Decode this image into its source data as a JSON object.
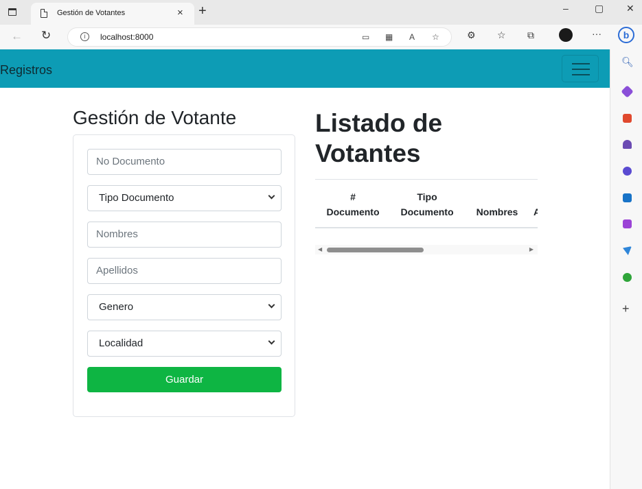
{
  "browser": {
    "tab_title": "Gestión de Votantes",
    "tab_close": "×",
    "new_tab": "+",
    "window_controls": [
      "–",
      "▢",
      "✕"
    ],
    "url": "localhost:8000",
    "toolbar_icons": [
      "app-icon",
      "qr-icon",
      "read-aloud-icon",
      "favorite-add-icon",
      "extensions-icon",
      "favorites-icon",
      "collections-icon",
      "profile-avatar",
      "more-icon"
    ],
    "more_label": "···",
    "bing_label": "b"
  },
  "sidebar": {
    "icons": [
      "search-icon",
      "shopping-icon",
      "tools-icon",
      "games-icon",
      "office-icon",
      "outlook-icon",
      "designer-icon",
      "send-icon",
      "tree-icon"
    ],
    "plus": "+"
  },
  "navbar": {
    "brand": "Registros"
  },
  "form": {
    "title": "Gestión de Votante",
    "no_documento_placeholder": "No Documento",
    "tipo_documento": "Tipo Documento",
    "nombres_placeholder": "Nombres",
    "apellidos_placeholder": "Apellidos",
    "genero": "Genero",
    "localidad": "Localidad",
    "save_label": "Guardar"
  },
  "list": {
    "title": "Listado de Votantes",
    "columns": [
      {
        "line1": "#",
        "line2": "Documento"
      },
      {
        "line1": "Tipo",
        "line2": "Documento"
      },
      {
        "line1": "",
        "line2": "Nombres"
      },
      {
        "line1": "",
        "line2": "A"
      }
    ],
    "scroll_position": 0.0
  },
  "colors": {
    "navbar": "#0d9cb5",
    "save_button": "#0eb543"
  }
}
